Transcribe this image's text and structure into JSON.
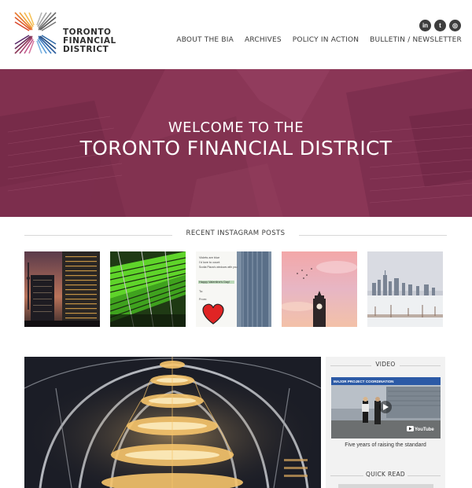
{
  "header": {
    "logo_lines": [
      "TORONTO",
      "FINANCIAL",
      "DISTRICT"
    ],
    "social": [
      {
        "icon": "linkedin-icon",
        "glyph": "in"
      },
      {
        "icon": "twitter-icon",
        "glyph": "t"
      },
      {
        "icon": "instagram-icon",
        "glyph": "◎"
      }
    ],
    "nav": [
      "ABOUT THE BIA",
      "ARCHIVES",
      "POLICY IN ACTION",
      "BULLETIN / NEWSLETTER"
    ]
  },
  "hero": {
    "line1": "WELCOME TO THE",
    "line2": "TORONTO FINANCIAL DISTRICT",
    "color": "#8a3656"
  },
  "instagram": {
    "heading": "RECENT INSTAGRAM POSTS",
    "posts": [
      {
        "name": "night-towers"
      },
      {
        "name": "green-escalators"
      },
      {
        "name": "valentine-note",
        "note_lines": [
          "Violets are blue",
          "I'd love to count",
          "Scotia Plaza's windows with you",
          "Happy Valentine's Day!",
          "To:",
          "From:"
        ]
      },
      {
        "name": "old-city-hall-clock"
      },
      {
        "name": "winter-skyline"
      }
    ]
  },
  "sidebar": {
    "video_heading": "VIDEO",
    "video_banner": "MAJOR PROJECT COORDINATION",
    "video_brand": "YouTube",
    "video_caption": "Five years of raising the standard",
    "quick_read_heading": "QUICK READ"
  }
}
